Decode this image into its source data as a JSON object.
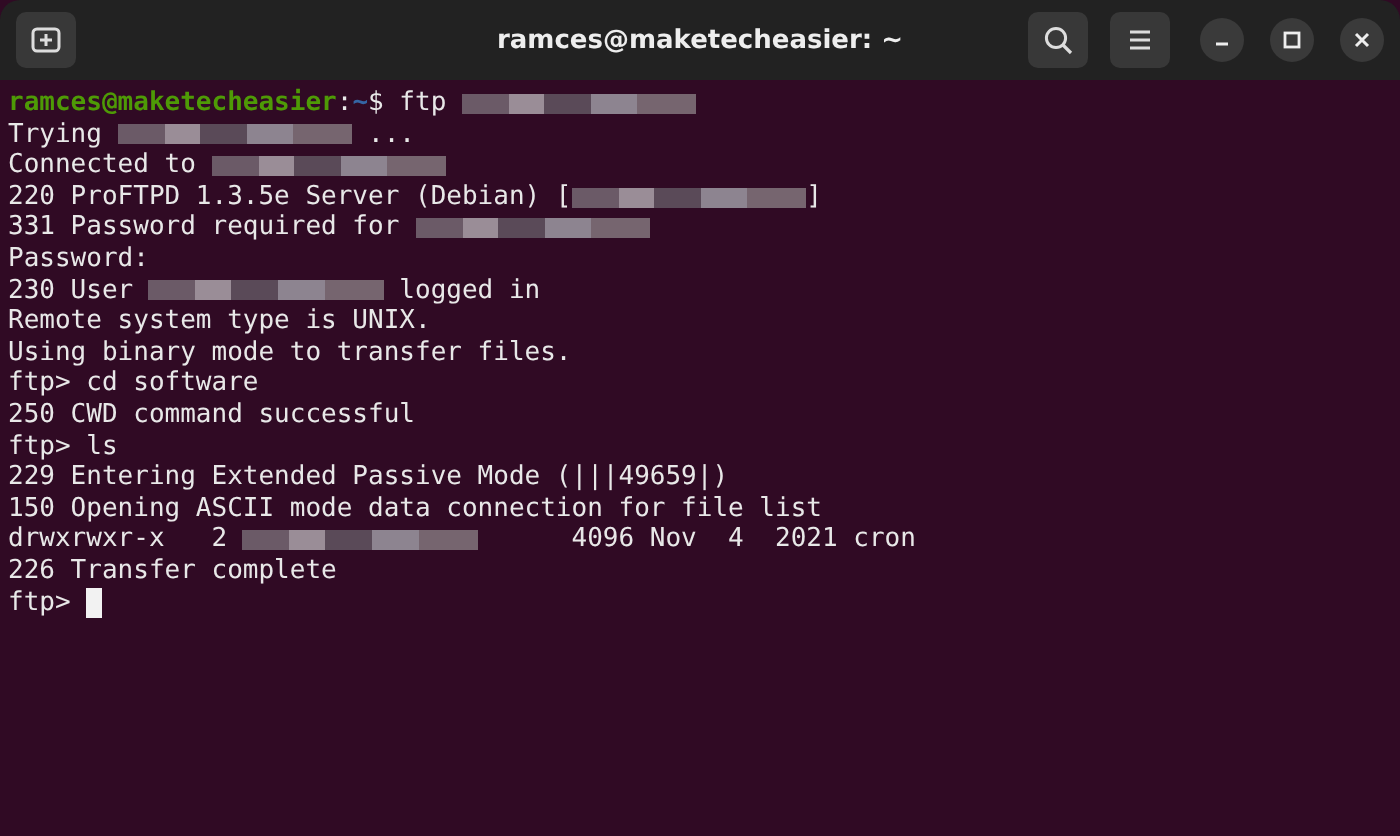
{
  "window": {
    "title": "ramces@maketecheasier: ~"
  },
  "terminal": {
    "lines": [
      [
        {
          "kind": "user",
          "text": "ramces@maketecheasier"
        },
        {
          "kind": "text",
          "text": ":"
        },
        {
          "kind": "path",
          "text": "~"
        },
        {
          "kind": "text",
          "text": "$ ftp "
        },
        {
          "kind": "redacted"
        }
      ],
      [
        {
          "kind": "text",
          "text": "Trying "
        },
        {
          "kind": "redacted"
        },
        {
          "kind": "text",
          "text": " ..."
        }
      ],
      [
        {
          "kind": "text",
          "text": "Connected to "
        },
        {
          "kind": "redacted"
        }
      ],
      [
        {
          "kind": "text",
          "text": "220 ProFTPD 1.3.5e Server (Debian) ["
        },
        {
          "kind": "redacted"
        },
        {
          "kind": "text",
          "text": "]"
        }
      ],
      [
        {
          "kind": "text",
          "text": "331 Password required for "
        },
        {
          "kind": "redacted"
        }
      ],
      [
        {
          "kind": "text",
          "text": "Password:"
        }
      ],
      [
        {
          "kind": "text",
          "text": "230 User "
        },
        {
          "kind": "redacted"
        },
        {
          "kind": "text",
          "text": " logged in"
        }
      ],
      [
        {
          "kind": "text",
          "text": "Remote system type is UNIX."
        }
      ],
      [
        {
          "kind": "text",
          "text": "Using binary mode to transfer files."
        }
      ],
      [
        {
          "kind": "text",
          "text": "ftp> cd software"
        }
      ],
      [
        {
          "kind": "text",
          "text": "250 CWD command successful"
        }
      ],
      [
        {
          "kind": "text",
          "text": "ftp> ls"
        }
      ],
      [
        {
          "kind": "text",
          "text": "229 Entering Extended Passive Mode (|||49659|)"
        }
      ],
      [
        {
          "kind": "text",
          "text": "150 Opening ASCII mode data connection for file list"
        }
      ],
      [
        {
          "kind": "text",
          "text": "drwxrwxr-x   2 "
        },
        {
          "kind": "redacted"
        },
        {
          "kind": "text",
          "text": "      4096 Nov  4  2021 cron"
        }
      ],
      [
        {
          "kind": "text",
          "text": "226 Transfer complete"
        }
      ],
      [
        {
          "kind": "text",
          "text": "ftp> "
        },
        {
          "kind": "cursor"
        }
      ]
    ]
  }
}
